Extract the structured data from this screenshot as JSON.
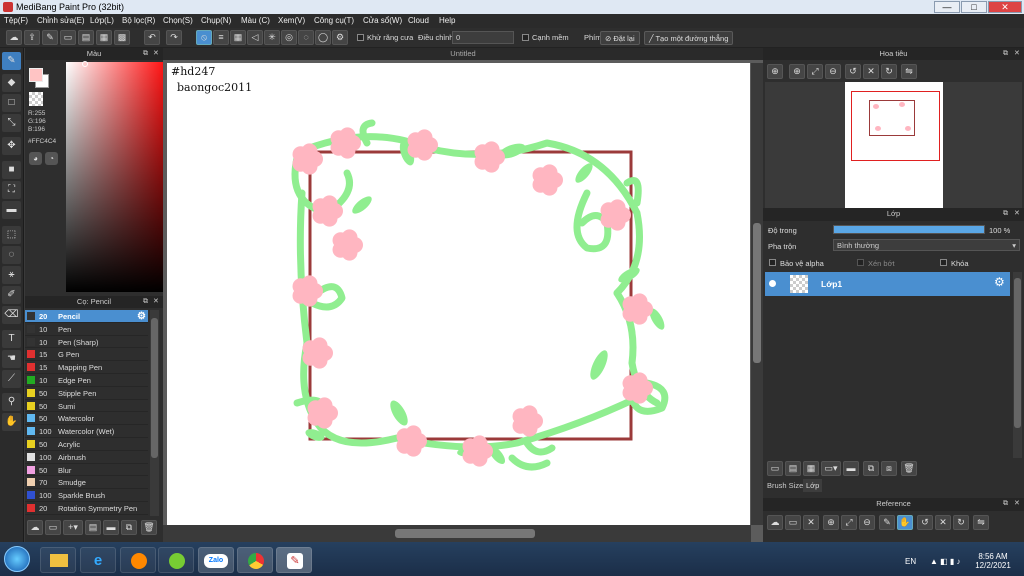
{
  "titlebar": {
    "title": "MediBang Paint Pro (32bit)",
    "min": "—",
    "max": "□",
    "close": "✕"
  },
  "menu": [
    "Tệp(F)",
    "Chỉnh sửa(E)",
    "Lớp(L)",
    "Bộ lọc(R)",
    "Chọn(S)",
    "Chụp(N)",
    "Màu (C)",
    "Xem(V)",
    "Công cụ(T)",
    "Cửa sổ(W)",
    "Cloud",
    "Help"
  ],
  "toolbar": {
    "antialias_label": "Khử răng cưa",
    "adjust_label": "Điều chỉnh",
    "adjust_value": "0",
    "snap_label": "Cạnh mềm",
    "key_label": "Phím",
    "reset_label": "Đặt lại",
    "line_label": "Tạo một đường thẳng"
  },
  "color_panel": {
    "title": "Màu",
    "r": "R:255",
    "g": "G:196",
    "b": "B:196",
    "hex": "#FFC4C4",
    "primary_color": "#ffc4c4",
    "secondary_color": "#ffffff"
  },
  "brush_panel": {
    "title": "Cọ: Pencil",
    "items": [
      {
        "size": "20",
        "name": "Pencil",
        "color": "#333333"
      },
      {
        "size": "10",
        "name": "Pen",
        "color": "#333333"
      },
      {
        "size": "10",
        "name": "Pen (Sharp)",
        "color": "#333333"
      },
      {
        "size": "15",
        "name": "G Pen",
        "color": "#e03030"
      },
      {
        "size": "15",
        "name": "Mapping Pen",
        "color": "#e03030"
      },
      {
        "size": "10",
        "name": "Edge Pen",
        "color": "#22aa22"
      },
      {
        "size": "50",
        "name": "Stipple Pen",
        "color": "#e8d020"
      },
      {
        "size": "50",
        "name": "Sumi",
        "color": "#e8d020"
      },
      {
        "size": "50",
        "name": "Watercolor",
        "color": "#60b8f0"
      },
      {
        "size": "100",
        "name": "Watercolor (Wet)",
        "color": "#60b8f0"
      },
      {
        "size": "50",
        "name": "Acrylic",
        "color": "#e8d020"
      },
      {
        "size": "100",
        "name": "Airbrush",
        "color": "#e0e0e0"
      },
      {
        "size": "50",
        "name": "Blur",
        "color": "#f0a0e0"
      },
      {
        "size": "70",
        "name": "Smudge",
        "color": "#f0d0b0"
      },
      {
        "size": "100",
        "name": "Sparkle Brush",
        "color": "#3050d0"
      },
      {
        "size": "20",
        "name": "Rotation Symmetry Pen",
        "color": "#e03030"
      }
    ]
  },
  "canvas": {
    "tab_title": "Untitled",
    "text_line1": "#hd247",
    "text_line2": "baongoc2011",
    "frame_color": "#9b3a3a",
    "vine_color": "#90ee90",
    "flower_color": "#ffb6c1"
  },
  "navigator": {
    "title": "Hoa tiêu"
  },
  "layer_panel": {
    "title": "Lớp",
    "opacity_label": "Độ trong",
    "opacity_value": "100 %",
    "opacity_fraction": 1.0,
    "blend_label": "Pha trộn",
    "blend_value": "Bình thường",
    "protect_alpha": "Bảo vệ alpha",
    "clipping": "Xén bớt",
    "lock": "Khóa",
    "layers": [
      {
        "name": "Lớp1"
      }
    ],
    "tab_brush_size": "Brush Size",
    "tab_layer": "Lớp"
  },
  "reference_panel": {
    "title": "Reference"
  },
  "taskbar": {
    "lang": "EN",
    "time": "8:56 AM",
    "date": "12/2/2021",
    "zalo": "Zalo"
  }
}
